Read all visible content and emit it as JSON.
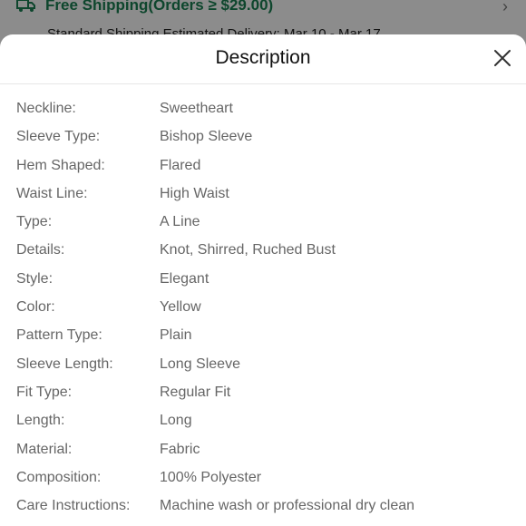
{
  "background": {
    "shipping_title": "Free Shipping(Orders ≥ $29.00)",
    "delivery_text": "Standard Shipping Estimated Delivery: Mar 10 - Mar 17",
    "truck_icon": "truck-icon",
    "chevron_icon": "chevron-right-icon"
  },
  "modal": {
    "title": "Description",
    "close_icon": "close-icon",
    "specs": [
      {
        "key": "Neckline:",
        "value": "Sweetheart"
      },
      {
        "key": "Sleeve Type:",
        "value": "Bishop Sleeve"
      },
      {
        "key": "Hem Shaped:",
        "value": "Flared"
      },
      {
        "key": "Waist Line:",
        "value": "High Waist"
      },
      {
        "key": "Type:",
        "value": "A Line"
      },
      {
        "key": "Details:",
        "value": "Knot, Shirred, Ruched Bust"
      },
      {
        "key": "Style:",
        "value": "Elegant"
      },
      {
        "key": "Color:",
        "value": "Yellow"
      },
      {
        "key": "Pattern Type:",
        "value": "Plain"
      },
      {
        "key": "Sleeve Length:",
        "value": "Long Sleeve"
      },
      {
        "key": "Fit Type:",
        "value": "Regular Fit"
      },
      {
        "key": "Length:",
        "value": "Long"
      },
      {
        "key": "Material:",
        "value": "Fabric"
      },
      {
        "key": "Composition:",
        "value": "100% Polyester"
      },
      {
        "key": "Care Instructions:",
        "value": "Machine wash or professional dry clean"
      }
    ]
  },
  "colors": {
    "shipping_green": "#1b8052",
    "text_gray": "#666666",
    "overlay": "rgba(0,0,0,0.45)"
  }
}
